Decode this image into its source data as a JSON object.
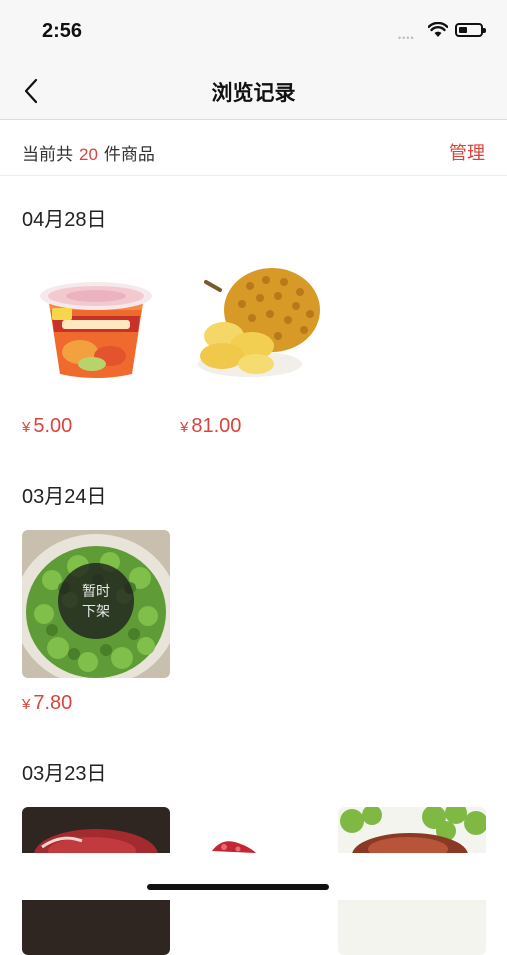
{
  "status_bar": {
    "time": "2:56",
    "signal_dots": "••••"
  },
  "nav": {
    "title": "浏览记录",
    "back_icon": "chevron-left-icon"
  },
  "summary": {
    "prefix": "当前共",
    "count": "20",
    "suffix": "件商品",
    "manage_label": "管理"
  },
  "groups": [
    {
      "date": "04月28日",
      "items": [
        {
          "name": "noodle-cup",
          "currency": "¥",
          "price": "5.00"
        },
        {
          "name": "durian",
          "currency": "¥",
          "price": "81.00"
        }
      ]
    },
    {
      "date": "03月24日",
      "items": [
        {
          "name": "greens",
          "currency": "¥",
          "price": "7.80",
          "badge_line1": "暂时",
          "badge_line2": "下架"
        }
      ]
    },
    {
      "date": "03月23日",
      "items": [
        {
          "name": "beef"
        },
        {
          "name": "meat-slice"
        },
        {
          "name": "meat-salad"
        }
      ]
    }
  ],
  "colors": {
    "accent": "#d9443c",
    "nav_bg": "#f7f7f7"
  }
}
